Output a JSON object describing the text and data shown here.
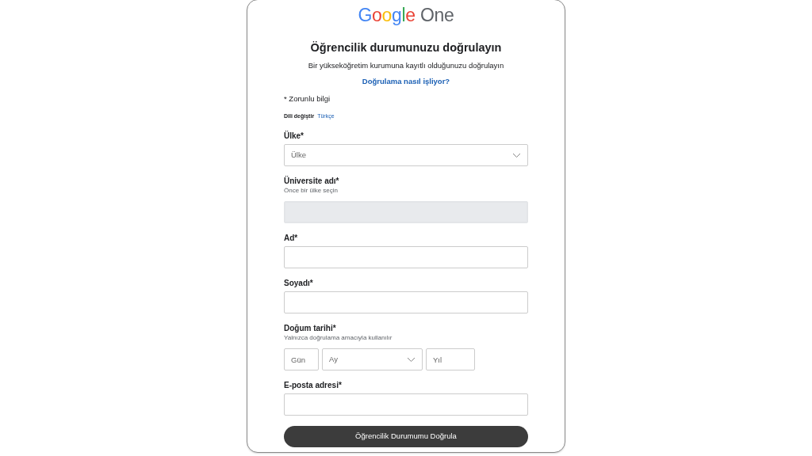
{
  "logo": {
    "brand": "Google",
    "product": "One"
  },
  "title": "Öğrencilik durumunuzu doğrulayın",
  "subtitle": "Bir yükseköğretim kurumuna kayıtlı olduğunuzu doğrulayın",
  "help_link": "Doğrulama nasıl işliyor?",
  "required_note": "* Zorunlu bilgi",
  "language": {
    "label": "Dili değiştir",
    "value": "Türkçe"
  },
  "fields": [
    {
      "kind": "select",
      "label": "Ülke*",
      "placeholder": "Ülke",
      "disabled": false
    },
    {
      "kind": "text",
      "label": "Üniversite adı*",
      "hint": "Önce bir ülke seçin",
      "disabled": true
    },
    {
      "kind": "text",
      "label": "Ad*",
      "disabled": false
    },
    {
      "kind": "text",
      "label": "Soyadı*",
      "disabled": false
    },
    {
      "kind": "date",
      "label": "Doğum tarihi*",
      "hint": "Yalnızca doğrulama amacıyla kullanılır",
      "day_placeholder": "Gün",
      "month_placeholder": "Ay",
      "year_placeholder": "Yıl"
    },
    {
      "kind": "text",
      "label": "E-posta adresi*",
      "disabled": false
    }
  ],
  "submit": "Öğrencilik Durumumu Doğrula"
}
